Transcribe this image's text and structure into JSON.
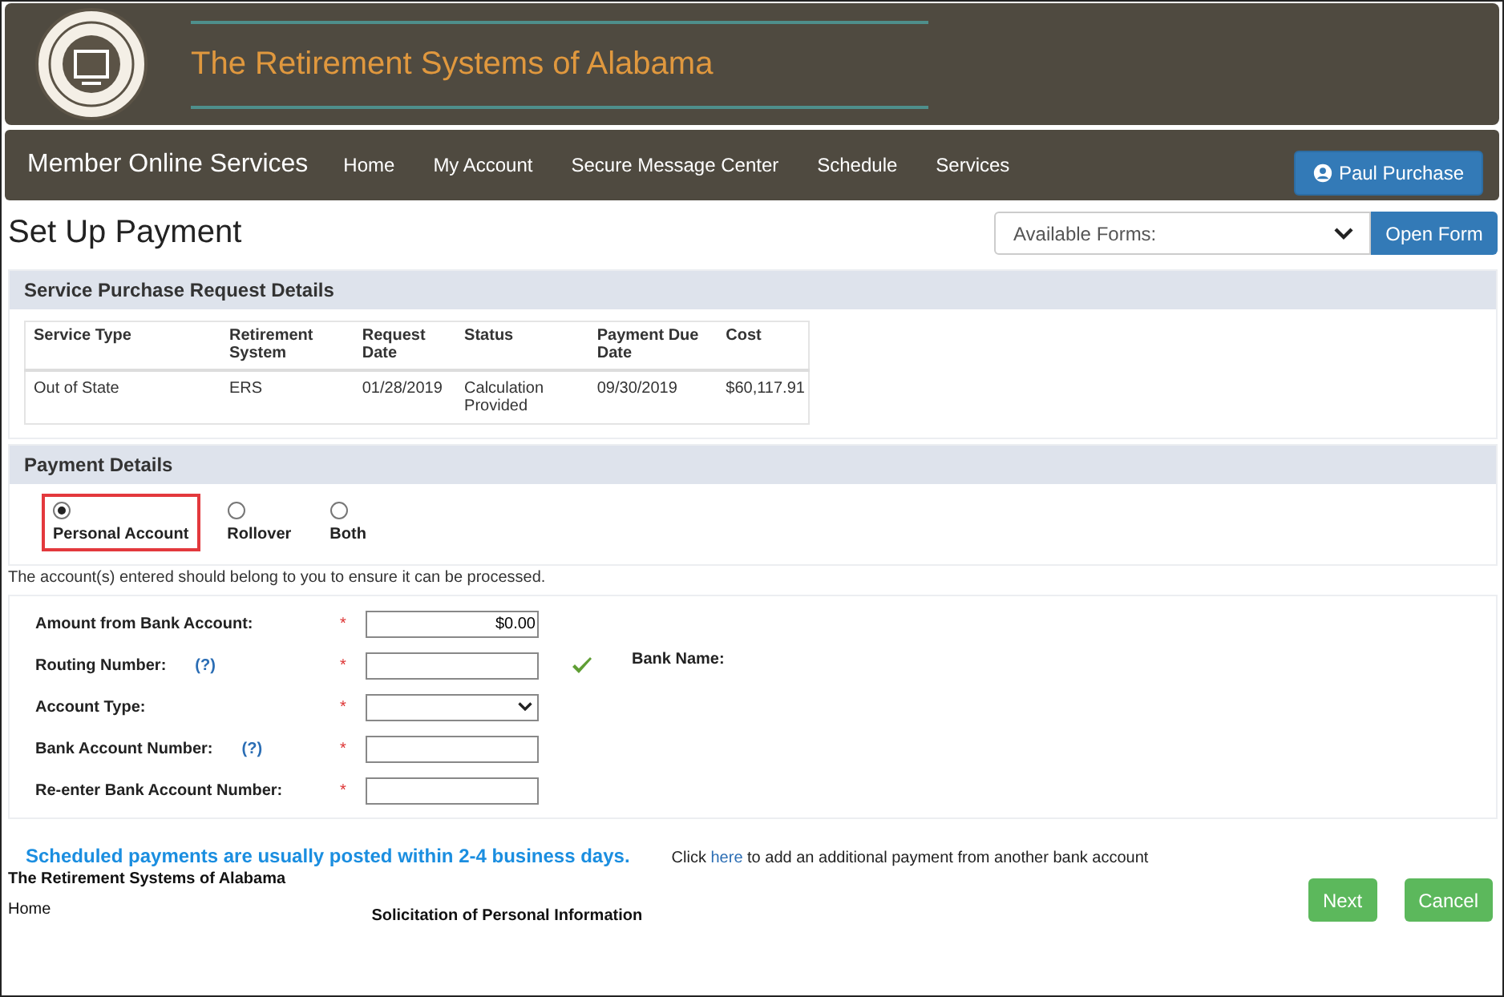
{
  "header": {
    "title": "The Retirement Systems of Alabama"
  },
  "nav": {
    "brand": "Member Online Services",
    "items": [
      "Home",
      "My Account",
      "Secure Message Center",
      "Schedule",
      "Services"
    ],
    "user_button": "Paul Purchase"
  },
  "page_title": "Set Up Payment",
  "forms": {
    "placeholder": "Available Forms:",
    "button": "Open Form"
  },
  "request_details": {
    "title": "Service Purchase Request Details",
    "columns": [
      "Service Type",
      "Retirement System",
      "Request Date",
      "Status",
      "Payment Due Date",
      "Cost"
    ],
    "rows": [
      [
        "Out of State",
        "ERS",
        "01/28/2019",
        "Calculation Provided",
        "09/30/2019",
        "$60,117.91"
      ]
    ]
  },
  "payment_details": {
    "title": "Payment Details",
    "options": [
      {
        "label": "Personal Account",
        "selected": true,
        "highlighted": true
      },
      {
        "label": "Rollover",
        "selected": false,
        "highlighted": false
      },
      {
        "label": "Both",
        "selected": false,
        "highlighted": false
      }
    ]
  },
  "note": "The account(s) entered should belong to you to ensure it can be processed.",
  "fields": [
    {
      "kind": "input",
      "label": "Amount from Bank Account:",
      "required": "*",
      "value": "$0.00"
    },
    {
      "kind": "input",
      "label": "Routing Number:",
      "help": "(?)",
      "required": "*",
      "verified": true,
      "aside": "Bank Name:"
    },
    {
      "kind": "select",
      "label": "Account Type:",
      "required": "*"
    },
    {
      "kind": "input",
      "label": "Bank Account Number:",
      "help": "(?)",
      "required": "*"
    },
    {
      "kind": "input",
      "label": "Re-enter Bank Account Number:",
      "required": "*"
    }
  ],
  "schedule_note": "Scheduled payments are usually posted within 2-4 business days.",
  "add_payment": {
    "before": "Click",
    "link": "here",
    "after": "to add an additional payment from another bank account"
  },
  "buttons": [
    "Next",
    "Cancel"
  ],
  "footer": {
    "title": "The Retirement Systems of Alabama",
    "links": [
      "Home"
    ],
    "column_2": "Solicitation of Personal Information"
  }
}
